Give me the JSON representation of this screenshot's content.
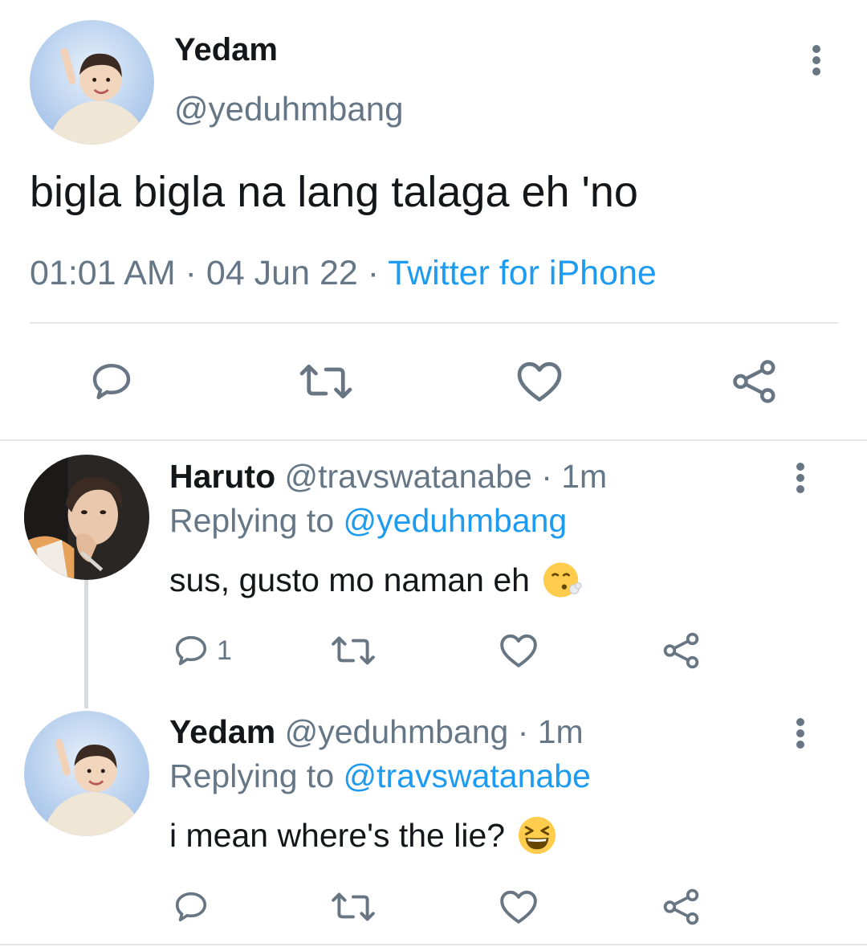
{
  "main_tweet": {
    "name": "Yedam",
    "handle": "@yeduhmbang",
    "text": "bigla bigla na lang talaga eh 'no",
    "time": "01:01 AM",
    "sep1": " · ",
    "date": "04 Jun 22",
    "sep2": " · ",
    "source": "Twitter for iPhone",
    "avatar_icon": "user-avatar-photo",
    "more_icon": "more-vertical-icon"
  },
  "actions": {
    "reply_icon": "reply-icon",
    "retweet_icon": "retweet-icon",
    "like_icon": "like-icon",
    "share_icon": "share-icon"
  },
  "replies": [
    {
      "name": "Haruto",
      "handle": "@travswatanabe",
      "sep": " · ",
      "time": "1m",
      "replying_label": "Replying to ",
      "replying_to": "@yeduhmbang",
      "text": "sus, gusto mo naman eh",
      "emoji_icon": "face-exhaling-emoji",
      "reply_count": "1"
    },
    {
      "name": "Yedam",
      "handle": "@yeduhmbang",
      "sep": " · ",
      "time": "1m",
      "replying_label": "Replying to ",
      "replying_to": "@travswatanabe",
      "text": "i mean where's the lie?",
      "emoji_icon": "grinning-squinting-face-emoji",
      "reply_count": ""
    }
  ],
  "colors": {
    "text": "#14171a",
    "secondary": "#657786",
    "link": "#1d9bf0",
    "divider": "#e3e7ea"
  }
}
